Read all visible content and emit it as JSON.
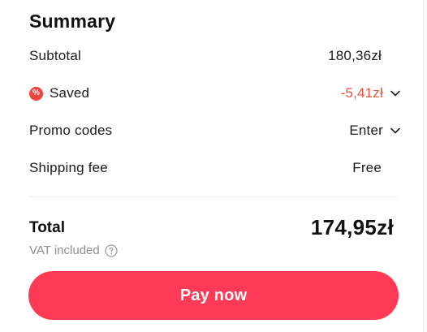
{
  "summary": {
    "title": "Summary",
    "subtotal": {
      "label": "Subtotal",
      "value": "180,36zł"
    },
    "saved": {
      "label": "Saved",
      "value": "-5,41zł",
      "icon_symbol": "%",
      "icon": "discount-badge-icon",
      "color": "#e8533d"
    },
    "promo": {
      "label": "Promo codes",
      "value": "Enter"
    },
    "shipping": {
      "label": "Shipping fee",
      "value": "Free"
    },
    "total": {
      "label": "Total",
      "value": "174,95zł"
    },
    "vat": {
      "label": "VAT included",
      "icon": "help-circle-icon"
    },
    "pay_button": {
      "label": "Pay now",
      "color": "#ff3a56"
    }
  }
}
